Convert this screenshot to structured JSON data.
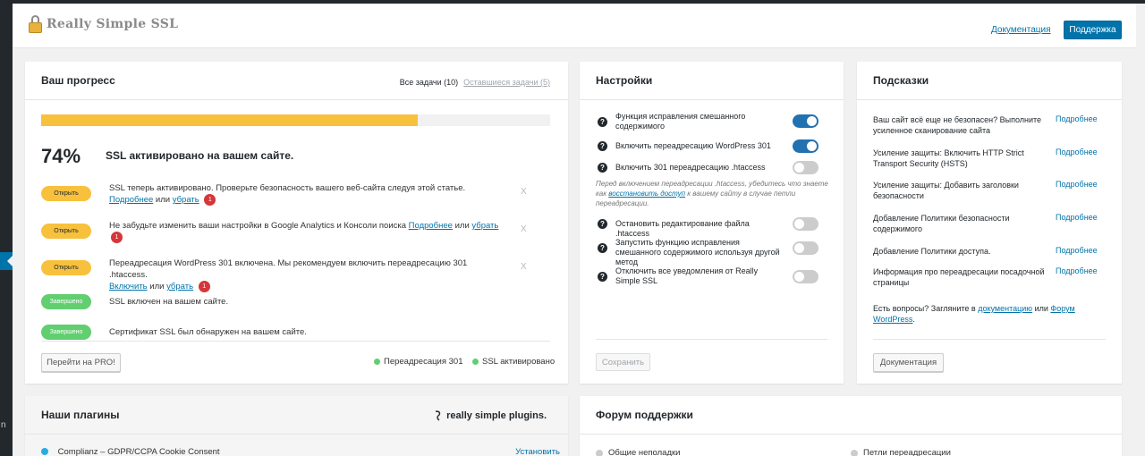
{
  "header": {
    "logo_text": "Really Simple SSL",
    "doc_link": "Документация",
    "support_button": "Поддержка"
  },
  "progress": {
    "title": "Ваш прогресс",
    "tab_all": "Все задачи (10)",
    "tab_remaining": "Оставшиеся задачи (5)",
    "percent_value": 74,
    "percent_label": "74%",
    "status_message": "SSL активировано на вашем сайте.",
    "tasks": [
      {
        "badge": "Открыть",
        "text": "SSL теперь активировано. Проверьте безопасность вашего веб-сайта следуя этой статье.",
        "more": "Подробнее",
        "or": "или",
        "remove": "убрать",
        "count": "1",
        "dismiss": "X"
      },
      {
        "badge": "Открыть",
        "text": "Не забудьте изменить ваши настройки в Google Analytics и Консоли поиска",
        "more": "Подробнее",
        "or": "или",
        "remove": "убрать",
        "count": "1",
        "dismiss": "X"
      },
      {
        "badge": "Открыть",
        "text": "Переадресация WordPress 301 включена. Мы рекомендуем включить переадресацию 301 .htaccess.",
        "enable": "Включить",
        "or": "или",
        "remove": "убрать",
        "count": "1",
        "dismiss": "X"
      },
      {
        "badge": "Завершено",
        "text": "SSL включен на вашем сайте."
      },
      {
        "badge": "Завершено",
        "text": "Сертификат SSL был обнаружен на вашем сайте."
      }
    ],
    "pro_button": "Перейти на PRO!",
    "legend_redirect": "Переадресация 301",
    "legend_ssl": "SSL активировано",
    "colors": {
      "bar": "#f8c13d",
      "done": "#61ce70"
    }
  },
  "settings": {
    "title": "Настройки",
    "items": [
      {
        "label": "Функция исправления смешанного содержимого",
        "on": true
      },
      {
        "label": "Включить переадресацию WordPress 301",
        "on": true
      },
      {
        "label": "Включить 301 переадресацию .htaccess",
        "on": false
      },
      {
        "label": "Остановить редактирование файла .htaccess",
        "on": false
      },
      {
        "label": "Запустить функцию исправления смешанного содержимого используя другой метод",
        "on": false
      },
      {
        "label": "Отключить все уведомления от Really Simple SSL",
        "on": false
      }
    ],
    "note_before": "Перед включением переадресации .htaccess, убедитесь что знаете как",
    "note_link": "восстановить доступ",
    "note_after": "к вашему сайту в случае петли переадресации.",
    "save_button": "Сохранить"
  },
  "tips": {
    "title": "Подсказки",
    "items": [
      {
        "text": "Ваш сайт всё еще не безопасен? Выполните усиленное сканирование сайта",
        "link": "Подробнее"
      },
      {
        "text": "Усиление защиты: Включить HTTP Strict Transport Security (HSTS)",
        "link": "Подробнее"
      },
      {
        "text": "Усиление защиты: Добавить заголовки безопасности",
        "link": "Подробнее"
      },
      {
        "text": "Добавление Политики безопасности содержимого",
        "link": "Подробнее"
      },
      {
        "text": "Добавление Политики доступа.",
        "link": "Подробнее"
      },
      {
        "text": "Информация про переадресации посадочной страницы",
        "link": "Подробнее"
      }
    ],
    "question_before": "Есть вопросы? Загляните в",
    "question_docs": "документацию",
    "question_or": "или",
    "question_forum": "Форум WordPress",
    "question_end": ".",
    "doc_button": "Документация"
  },
  "plugins": {
    "title": "Наши плагины",
    "brand": "really simple plugins.",
    "first_plugin": "Complianz – GDPR/CCPA Cookie Consent",
    "install": "Установить"
  },
  "forum": {
    "title": "Форум поддержки",
    "item1": "Общие неполадки",
    "item2": "Петли переадресации"
  }
}
